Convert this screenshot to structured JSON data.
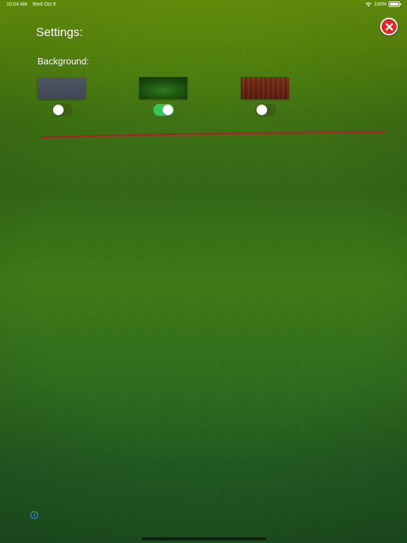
{
  "status_bar": {
    "time": "10:04 AM",
    "date": "Wed Oct 9",
    "battery": "100%"
  },
  "header": {
    "title": "Settings:"
  },
  "background_section": {
    "label": "Background:",
    "options": [
      {
        "name": "slate",
        "enabled": false
      },
      {
        "name": "green felt",
        "enabled": true
      },
      {
        "name": "wood",
        "enabled": false
      }
    ]
  },
  "footer": {
    "info_glyph": "i"
  },
  "colors": {
    "close_button": "#e22424",
    "toggle_on": "#34c759",
    "divider": "#c8102e",
    "info_icon": "#3a8ef0"
  }
}
